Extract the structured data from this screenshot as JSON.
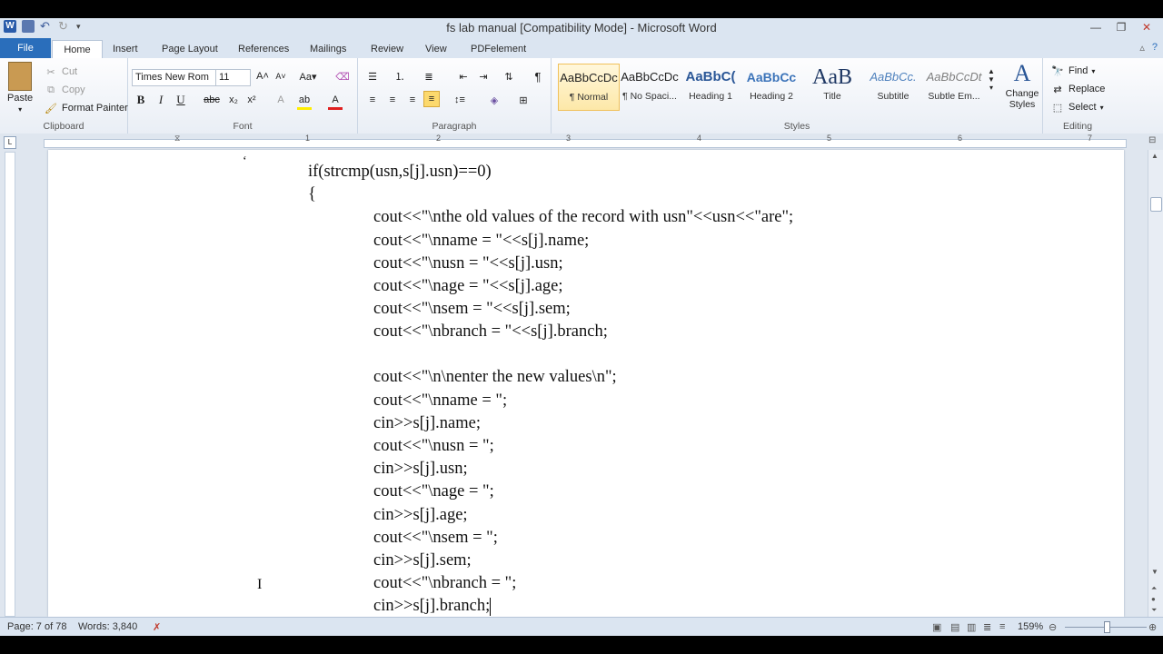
{
  "window": {
    "title": "fs lab manual [Compatibility Mode] - Microsoft Word"
  },
  "tabs": [
    "File",
    "Home",
    "Insert",
    "Page Layout",
    "References",
    "Mailings",
    "Review",
    "View",
    "PDFelement"
  ],
  "clipboard": {
    "paste": "Paste",
    "cut": "Cut",
    "copy": "Copy",
    "format_painter": "Format Painter",
    "label": "Clipboard"
  },
  "font": {
    "name": "Times New Rom",
    "size": "11",
    "label": "Font"
  },
  "paragraph": {
    "label": "Paragraph"
  },
  "styles": {
    "label": "Styles",
    "items": [
      {
        "preview": "AaBbCcDc",
        "name": "¶ Normal"
      },
      {
        "preview": "AaBbCcDc",
        "name": "¶ No Spaci..."
      },
      {
        "preview": "AaBbC(",
        "name": "Heading 1"
      },
      {
        "preview": "AaBbCc",
        "name": "Heading 2"
      },
      {
        "preview": "AaB",
        "name": "Title"
      },
      {
        "preview": "AaBbCc.",
        "name": "Subtitle"
      },
      {
        "preview": "AaBbCcDt",
        "name": "Subtle Em..."
      }
    ],
    "change_styles": "Change Styles"
  },
  "editing": {
    "find": "Find",
    "replace": "Replace",
    "select": "Select",
    "label": "Editing"
  },
  "ruler_numbers": [
    "1",
    "1",
    "2",
    "3",
    "4",
    "5",
    "6",
    "7"
  ],
  "document": {
    "lines": [
      {
        "text": "if(strcmp(usn,s[j].usn)==0)",
        "indent": 1
      },
      {
        "text": "{",
        "indent": 1
      },
      {
        "text": "cout<<\"\\nthe old values of the record with usn\"<<usn<<\"are\";",
        "indent": 2
      },
      {
        "text": "cout<<\"\\nname = \"<<s[j].name;",
        "indent": 2
      },
      {
        "text": "cout<<\"\\nusn = \"<<s[j].usn;",
        "indent": 2
      },
      {
        "text": "cout<<\"\\nage = \"<<s[j].age;",
        "indent": 2
      },
      {
        "text": "cout<<\"\\nsem = \"<<s[j].sem;",
        "indent": 2
      },
      {
        "text": "cout<<\"\\nbranch = \"<<s[j].branch;",
        "indent": 2
      },
      {
        "text": "",
        "indent": 2
      },
      {
        "text": "cout<<\"\\n\\nenter the new values\\n\";",
        "indent": 2
      },
      {
        "text": "cout<<\"\\nname = \";",
        "indent": 2
      },
      {
        "text": "cin>>s[j].name;",
        "indent": 2
      },
      {
        "text": "cout<<\"\\nusn = \";",
        "indent": 2
      },
      {
        "text": "cin>>s[j].usn;",
        "indent": 2
      },
      {
        "text": "cout<<\"\\nage = \";",
        "indent": 2
      },
      {
        "text": "cin>>s[j].age;",
        "indent": 2
      },
      {
        "text": "cout<<\"\\nsem = \";",
        "indent": 2
      },
      {
        "text": "cin>>s[j].sem;",
        "indent": 2
      },
      {
        "text": "cout<<\"\\nbranch = \";",
        "indent": 2
      },
      {
        "text": "cin>>s[j].branch;",
        "indent": 2
      }
    ]
  },
  "status": {
    "page": "Page: 7 of 78",
    "words": "Words: 3,840",
    "zoom": "159%"
  }
}
